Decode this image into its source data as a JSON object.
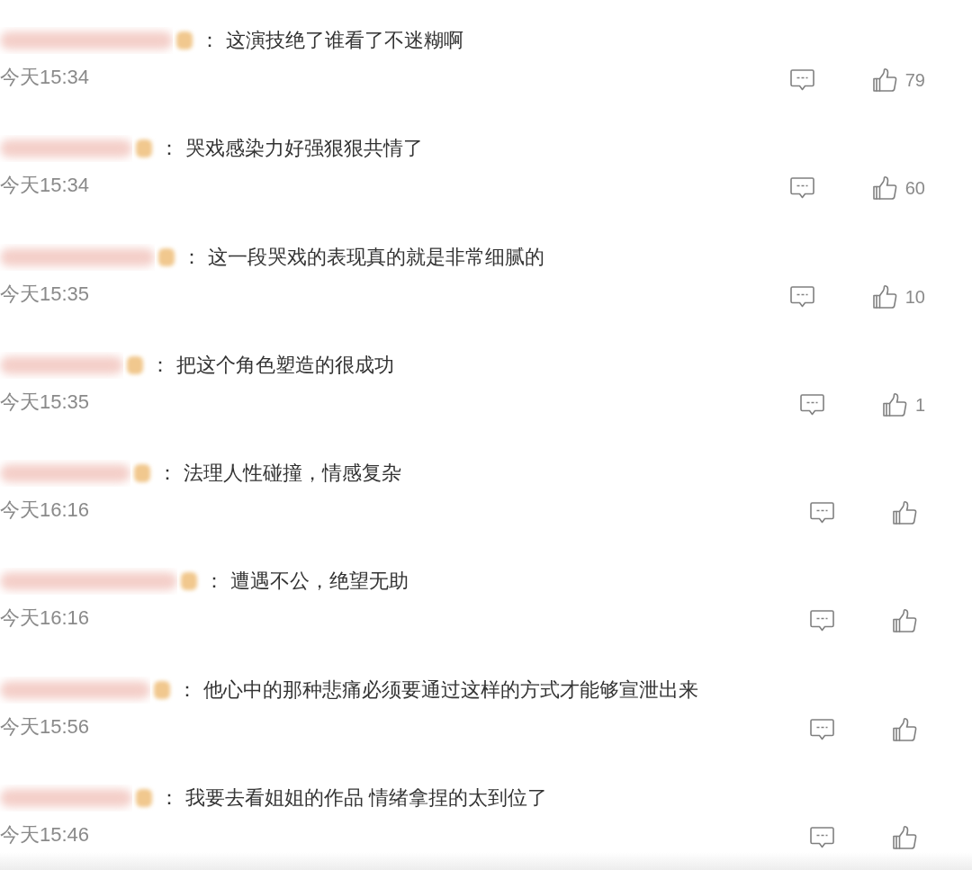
{
  "comments": [
    {
      "separator": "：",
      "text": "这演技绝了谁看了不迷糊啊",
      "time": "今天15:34",
      "likes": "79"
    },
    {
      "separator": "：",
      "text": "哭戏感染力好强狠狠共情了",
      "time": "今天15:34",
      "likes": "60"
    },
    {
      "separator": "：",
      "text": "这一段哭戏的表现真的就是非常细腻的",
      "time": "今天15:35",
      "likes": "10"
    },
    {
      "separator": "：",
      "text": "把这个角色塑造的很成功",
      "time": "今天15:35",
      "likes": "1"
    },
    {
      "separator": "：",
      "text": "法理人性碰撞，情感复杂",
      "time": "今天16:16"
    },
    {
      "separator": "：",
      "text": "遭遇不公，绝望无助",
      "time": "今天16:16"
    },
    {
      "separator": "：",
      "text": "他心中的那种悲痛必须要通过这样的方式才能够宣泄出来",
      "time": "今天15:56"
    },
    {
      "separator": "：",
      "text": "我要去看姐姐的作品 情绪拿捏的太到位了",
      "time": "今天15:46"
    }
  ]
}
